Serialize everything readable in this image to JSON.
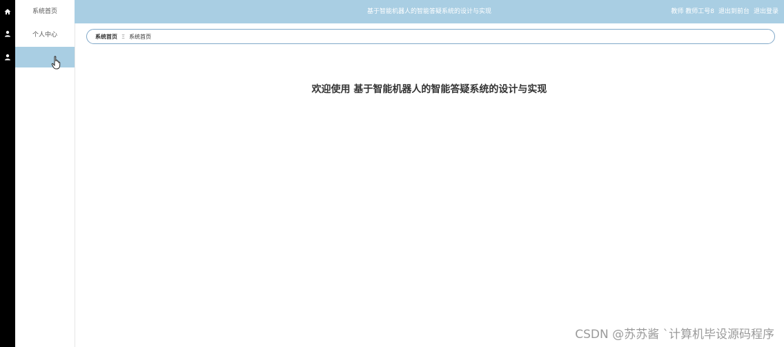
{
  "header": {
    "title": "基于智能机器人的智能答疑系统的设计与实现",
    "user_label": "教师 教师工号8",
    "exit_to_front_label": "退出到前台",
    "logout_label": "退出登录"
  },
  "sidebar": {
    "items": [
      {
        "label": "系统首页",
        "icon": "home-icon"
      },
      {
        "label": "个人中心",
        "icon": "user-icon"
      },
      {
        "label": "",
        "icon": "user-icon"
      }
    ]
  },
  "breadcrumb": {
    "root": "系统首页",
    "separator": "Ξ",
    "current": "系统首页"
  },
  "main": {
    "welcome": "欢迎使用 基于智能机器人的智能答疑系统的设计与实现"
  },
  "watermark": "CSDN @苏苏酱  ˋ计算机毕设源码程序",
  "colors": {
    "accent": "#a9cee3",
    "rail": "#000000"
  }
}
